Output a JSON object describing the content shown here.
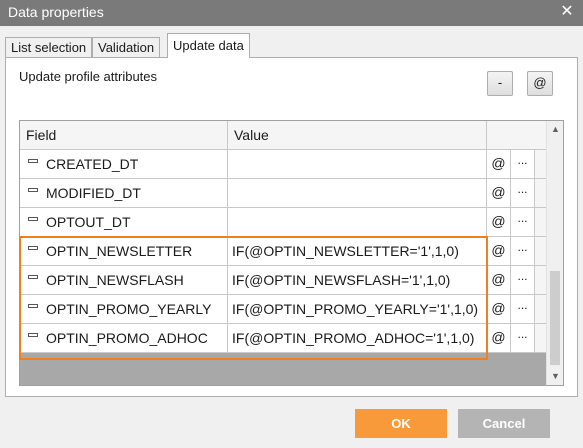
{
  "window": {
    "title": "Data properties",
    "close_glyph": "✕"
  },
  "tabs": [
    {
      "label": "List selection",
      "active": false
    },
    {
      "label": "Validation",
      "active": false
    },
    {
      "label": "Update data",
      "active": true
    }
  ],
  "panel": {
    "section_label": "Update profile attributes",
    "toolbar": {
      "remove_label": "-",
      "insert_label": "@"
    }
  },
  "grid": {
    "columns": [
      "Field",
      "Value"
    ],
    "at_label": "@",
    "more_label": "...",
    "rows": [
      {
        "field": "CREATED_DT",
        "value": ""
      },
      {
        "field": "MODIFIED_DT",
        "value": ""
      },
      {
        "field": "OPTOUT_DT",
        "value": ""
      },
      {
        "field": "OPTIN_NEWSLETTER",
        "value": "IF(@OPTIN_NEWSLETTER='1',1,0)"
      },
      {
        "field": "OPTIN_NEWSFLASH",
        "value": "IF(@OPTIN_NEWSFLASH='1',1,0)"
      },
      {
        "field": "OPTIN_PROMO_YEARLY",
        "value": "IF(@OPTIN_PROMO_YEARLY='1',1,0)"
      },
      {
        "field": "OPTIN_PROMO_ADHOC",
        "value": "IF(@OPTIN_PROMO_ADHOC='1',1,0)"
      }
    ],
    "scroll_up_glyph": "▲",
    "scroll_down_glyph": "▼"
  },
  "footer": {
    "ok_label": "OK",
    "cancel_label": "Cancel"
  },
  "colors": {
    "highlight": "#f07f1f",
    "ok_button": "#f89a3a",
    "cancel_button": "#b4b4b4",
    "titlebar": "#7a7a7a"
  }
}
